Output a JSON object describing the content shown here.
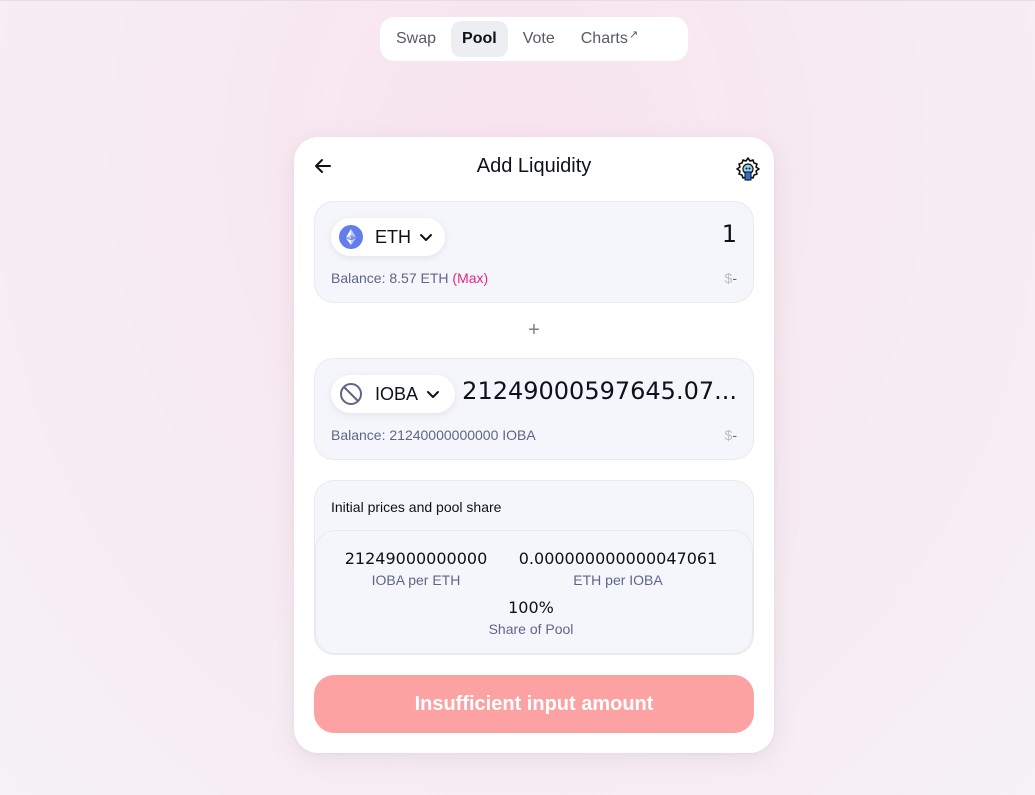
{
  "nav": {
    "items": [
      {
        "label": "Swap",
        "active": false
      },
      {
        "label": "Pool",
        "active": true
      },
      {
        "label": "Vote",
        "active": false
      },
      {
        "label": "Charts",
        "active": false,
        "external_icon": "arrow-up-right-icon"
      }
    ]
  },
  "card": {
    "title": "Add Liquidity",
    "back_icon": "arrow-left-icon",
    "settings_icon": "gear-icon"
  },
  "input_a": {
    "token_symbol": "ETH",
    "token_icon": "ethereum-icon",
    "amount": "1",
    "balance_text": "Balance: 8.57 ETH",
    "max_label": "(Max)",
    "usd_symbol": "$",
    "usd_value": "-"
  },
  "plus_label": "+",
  "input_b": {
    "token_symbol": "IOBA",
    "token_icon": "no-token-icon",
    "amount": "21249000597645.07...",
    "balance_text": "Balance: 21240000000000 IOBA",
    "usd_symbol": "$",
    "usd_value": "-"
  },
  "prices": {
    "title": "Initial prices and pool share",
    "rate_a_value": "21249000000000",
    "rate_a_label": "IOBA per ETH",
    "rate_b_value": "0.000000000000047061",
    "rate_b_label": "ETH per IOBA",
    "share_value": "100%",
    "share_label": "Share of Pool"
  },
  "cta": {
    "label": "Insufficient input amount",
    "color": "#fda2a3"
  },
  "colors": {
    "accent_pink": "#e5257f",
    "text_primary": "#0d111c",
    "text_secondary": "#5d6785"
  }
}
